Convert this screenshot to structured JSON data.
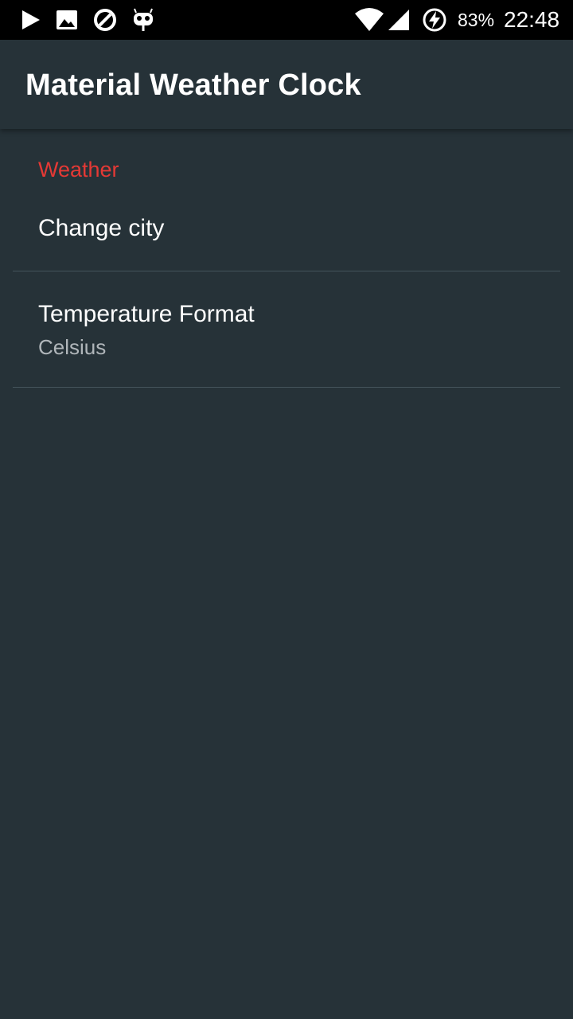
{
  "status_bar": {
    "icons_left": [
      "play-store-icon",
      "image-icon",
      "do-not-disturb-icon",
      "cyanogen-icon"
    ],
    "icons_right": [
      "wifi-icon",
      "cell-signal-icon",
      "battery-charging-icon"
    ],
    "battery": "83%",
    "time": "22:48"
  },
  "app_bar": {
    "title": "Material Weather Clock"
  },
  "preferences": {
    "category": "Weather",
    "change_city": {
      "title": "Change city"
    },
    "temperature_format": {
      "title": "Temperature Format",
      "summary": "Celsius"
    }
  },
  "colors": {
    "background": "#263238",
    "category_accent": "#e53935",
    "status_bar": "#000000",
    "text_primary": "#ffffff",
    "text_secondary": "#b0b6ba"
  }
}
